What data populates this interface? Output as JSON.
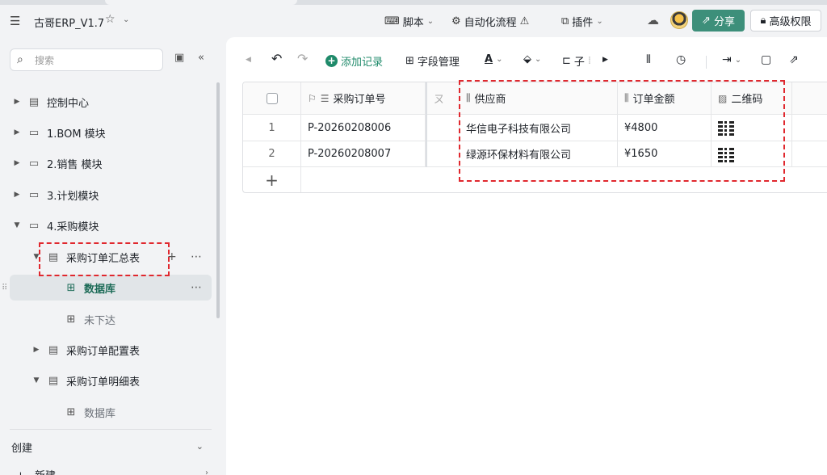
{
  "header": {
    "app_title": "古哥ERP_V1.7",
    "menu_icon": "menu-icon",
    "buttons": {
      "script": "脚本",
      "automation": "自动化流程",
      "plugin": "插件",
      "share": "分享",
      "permission": "高级权限"
    }
  },
  "sidebar": {
    "search_placeholder": "搜索",
    "tree": [
      {
        "label": "控制中心"
      },
      {
        "label": "1.BOM 模块"
      },
      {
        "label": "2.销售 模块"
      },
      {
        "label": "3.计划模块"
      },
      {
        "label": "4.采购模块"
      },
      {
        "label": "采购订单汇总表"
      },
      {
        "label": "数据库"
      },
      {
        "label": "未下达"
      },
      {
        "label": "采购订单配置表"
      },
      {
        "label": "采购订单明细表"
      },
      {
        "label": "数据库"
      }
    ],
    "create_label": "创建",
    "new_label": "新建"
  },
  "toolbar": {
    "add_record": "添加记录",
    "field_manage": "字段管理",
    "sub_label": "子"
  },
  "table": {
    "columns": [
      "采购订单号",
      "供应商",
      "订单金额",
      "二维码"
    ],
    "hidden_col_fragment": " ",
    "rows": [
      {
        "num": "1",
        "order_no": "P-20260208006",
        "supplier": "华信电子科技有限公司",
        "amount": "¥4800"
      },
      {
        "num": "2",
        "order_no": "P-20260208007",
        "supplier": "绿源环保材料有限公司",
        "amount": "¥1650"
      }
    ]
  },
  "colors": {
    "accent": "#3d8f7a",
    "active_text": "#1c6b57",
    "annotation": "#e0282e"
  }
}
